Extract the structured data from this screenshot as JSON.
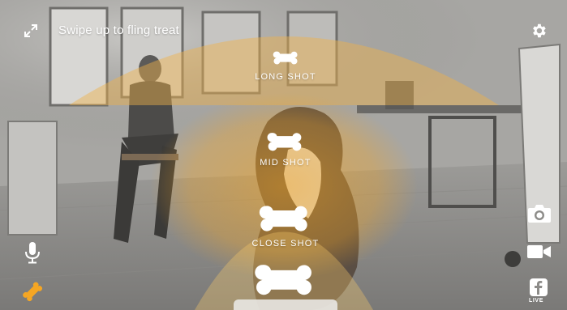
{
  "screen": {
    "hint_text": "Swipe up to fling treat",
    "colors": {
      "accent": "#f5a623",
      "overlay_text": "#ffffff"
    }
  },
  "shot_zones": [
    {
      "label": "LONG SHOT"
    },
    {
      "label": "MID SHOT"
    },
    {
      "label": "CLOSE SHOT"
    }
  ],
  "controls": {
    "expand_icon": "expand-icon",
    "settings_icon": "gear-icon",
    "mic_icon": "microphone-icon",
    "treat_icon": "bone-icon",
    "photo_icon": "camera-icon",
    "video_icon": "video-camera-icon",
    "facebook_icon": "facebook-icon",
    "facebook_live_label": "LIVE"
  }
}
